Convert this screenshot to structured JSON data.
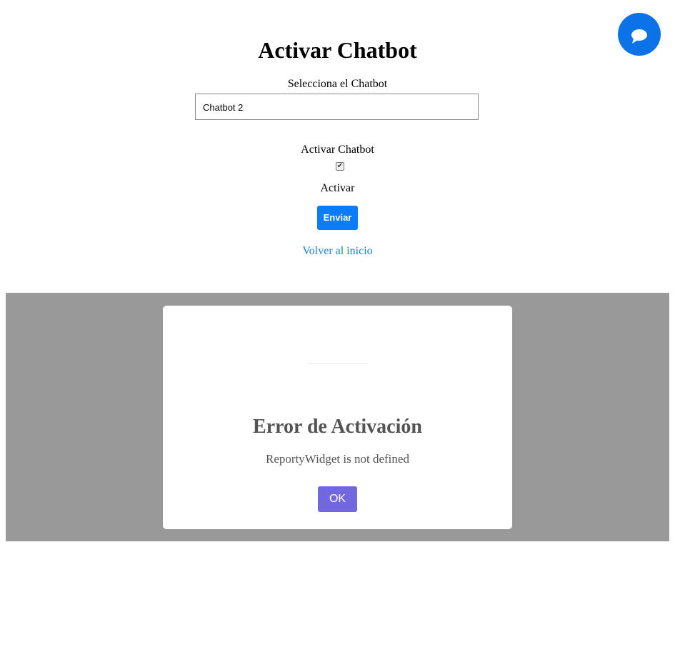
{
  "header": {
    "title": "Activar Chatbot"
  },
  "form": {
    "select_label": "Selecciona el Chatbot",
    "select_value": "Chatbot 2",
    "checkbox_label": "Activar Chatbot",
    "checkbox_checked": true,
    "checkbox_mark": "✔",
    "submit_label": "Activar",
    "submit_button": "Enviar",
    "back_link": "Volver al inicio"
  },
  "chat_widget": {
    "icon": "chat-icon",
    "color": "#0b72e7"
  },
  "modal": {
    "title": "Error de Activación",
    "message": "ReportyWidget is not defined",
    "ok_button": "OK",
    "ok_color": "#7367e0"
  },
  "colors": {
    "primary_button": "#0b7cf7",
    "link": "#1a7fd6",
    "overlay": "#999999"
  }
}
